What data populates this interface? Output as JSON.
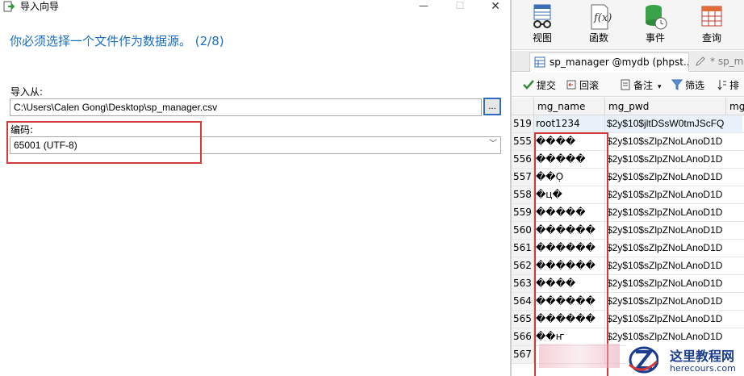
{
  "wizard": {
    "title": "导入向导",
    "step_heading": "你必须选择一个文件作为数据源。 (2/8)",
    "import_from_label": "导入从:",
    "import_path": "C:\\Users\\Calen Gong\\Desktop\\sp_manager.csv",
    "browse_label": "...",
    "encoding_label": "编码:",
    "encoding_value": "65001 (UTF-8)",
    "window_controls": {
      "minimize": "—",
      "maximize": "☐",
      "close": "✕"
    }
  },
  "toolbar": {
    "items": [
      {
        "label": "视图",
        "icon": "view-icon"
      },
      {
        "label": "函数",
        "icon": "function-icon"
      },
      {
        "label": "事件",
        "icon": "event-icon"
      },
      {
        "label": "查询",
        "icon": "query-icon"
      }
    ]
  },
  "tabs": [
    {
      "label": "sp_manager @mydb (phpst..."
    },
    {
      "label": "* sp_ma"
    }
  ],
  "actions": {
    "commit": "提交",
    "rollback": "回滚",
    "note": "备注",
    "filter": "筛选",
    "sort": "排"
  },
  "grid": {
    "columns": [
      "mg_name",
      "mg_pwd",
      "mg_"
    ],
    "rows": [
      {
        "id": "519",
        "name": "root1234",
        "pwd": "$2y$10$jltDSsW0tmJScFQ"
      },
      {
        "id": "555",
        "name": "����",
        "pwd": "$2y$10$sZlpZNoLAnoD1D"
      },
      {
        "id": "556",
        "name": "�����",
        "pwd": "$2y$10$sZlpZNoLAnoD1D"
      },
      {
        "id": "557",
        "name": "��Ọ",
        "pwd": "$2y$10$sZlpZNoLAnoD1D"
      },
      {
        "id": "558",
        "name": "�ц�",
        "pwd": "$2y$10$sZlpZNoLAnoD1D"
      },
      {
        "id": "559",
        "name": "�����",
        "pwd": "$2y$10$sZlpZNoLAnoD1D"
      },
      {
        "id": "560",
        "name": "������",
        "pwd": "$2y$10$sZlpZNoLAnoD1D"
      },
      {
        "id": "561",
        "name": "������",
        "pwd": "$2y$10$sZlpZNoLAnoD1D"
      },
      {
        "id": "562",
        "name": "������",
        "pwd": "$2y$10$sZlpZNoLAnoD1D"
      },
      {
        "id": "563",
        "name": "����",
        "pwd": "$2y$10$sZlpZNoLAnoD1D"
      },
      {
        "id": "564",
        "name": "������",
        "pwd": "$2y$10$sZlpZNoLAnoD1D"
      },
      {
        "id": "565",
        "name": "������",
        "pwd": "$2y$10$sZlpZNoLAnoD1D"
      },
      {
        "id": "566",
        "name": "��ҥ",
        "pwd": "$2y$10$sZlpZNoLAnoD1D"
      },
      {
        "id": "567",
        "name": "",
        "pwd": ""
      }
    ]
  },
  "watermark": {
    "cn": "这里教程网",
    "en": "herecours.com"
  },
  "colors": {
    "heading_blue": "#1a6fc4",
    "highlight_red": "#d23a3a",
    "watermark_blue": "#1b3d8f"
  }
}
